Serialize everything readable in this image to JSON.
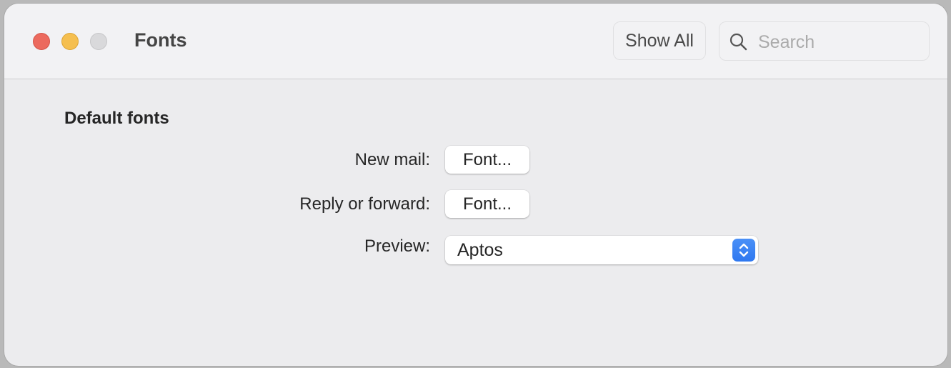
{
  "window": {
    "title": "Fonts",
    "controls": [
      "close",
      "minimize",
      "zoom"
    ]
  },
  "toolbar": {
    "show_all_label": "Show All",
    "search": {
      "placeholder": "Search",
      "value": "",
      "icon": "search-icon"
    }
  },
  "content": {
    "section_title": "Default fonts",
    "rows": [
      {
        "label": "New mail:",
        "button_label": "Font..."
      },
      {
        "label": "Reply or forward:",
        "button_label": "Font..."
      }
    ],
    "preview": {
      "label": "Preview:",
      "selected": "Aptos",
      "icon": "chevron-up-down-icon"
    }
  },
  "colors": {
    "close": "#ec6a5e",
    "minimize": "#f5bf4f",
    "zoom_inactive": "#d9d9db",
    "accent": "#2f78f0"
  }
}
